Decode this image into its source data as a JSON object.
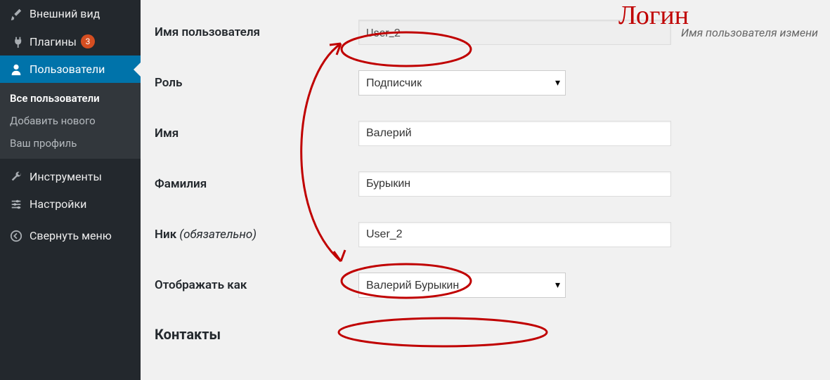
{
  "sidebar": {
    "items": [
      {
        "label": "Внешний вид",
        "icon": "brush"
      },
      {
        "label": "Плагины",
        "icon": "plug",
        "badge": "3"
      },
      {
        "label": "Пользователи",
        "icon": "user",
        "active": true
      },
      {
        "label": "Инструменты",
        "icon": "wrench"
      },
      {
        "label": "Настройки",
        "icon": "sliders"
      },
      {
        "label": "Свернуть меню",
        "icon": "collapse"
      }
    ],
    "sub": [
      {
        "label": "Все пользователи",
        "current": true
      },
      {
        "label": "Добавить нового",
        "current": false
      },
      {
        "label": "Ваш профиль",
        "current": false
      }
    ]
  },
  "form": {
    "top_cut": "Имя",
    "username_label": "Имя пользователя",
    "username_value": "User_2",
    "username_hint": "Имя пользователя измени",
    "role_label": "Роль",
    "role_value": "Подписчик",
    "firstname_label": "Имя",
    "firstname_value": "Валерий",
    "lastname_label": "Фамилия",
    "lastname_value": "Бурыкин",
    "nick_label": "Ник",
    "nick_req": "(обязательно)",
    "nick_value": "User_2",
    "display_label": "Отображать как",
    "display_value": "Валерий Бурыкин",
    "contacts_heading": "Контакты"
  },
  "annotation": {
    "title": "Логин"
  }
}
